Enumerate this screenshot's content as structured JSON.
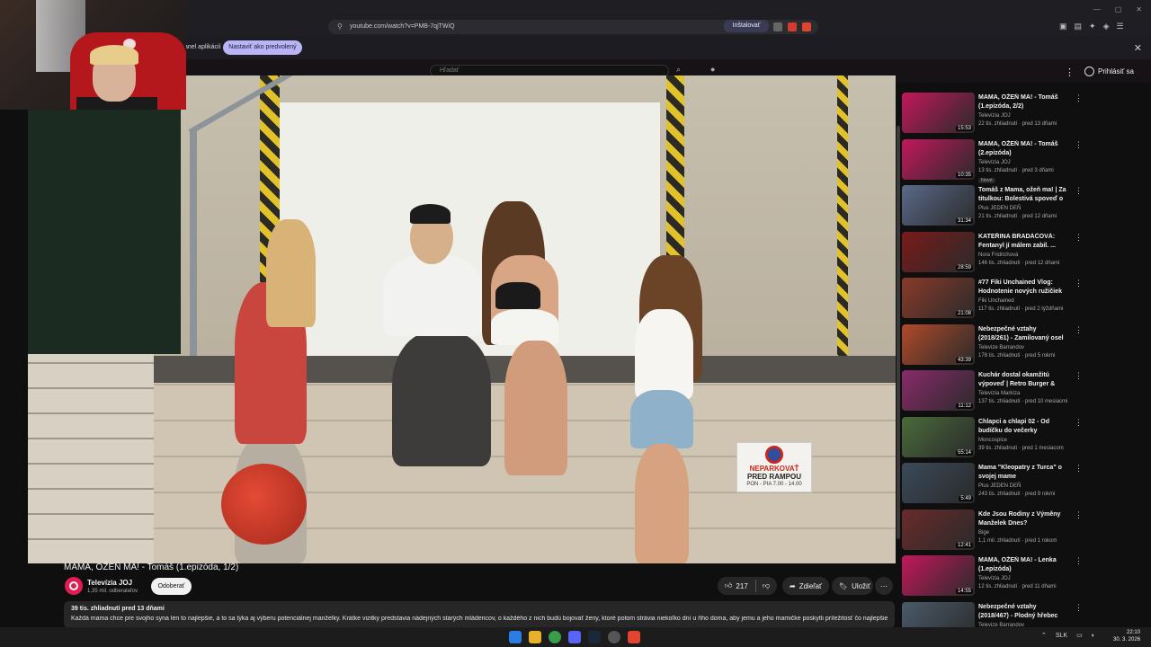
{
  "browser": {
    "url": "youtube.com/watch?v=PMB-7qjTWiQ",
    "install_label": "Inštalovať",
    "infobar_text": "anel aplikácií",
    "default_button": "Nastaviť ako predvolený"
  },
  "header": {
    "search_placeholder": "Hľadať",
    "signin_label": "Prihlásiť sa"
  },
  "video": {
    "title": "MAMA, OŽEŇ MA! - Tomáš (1.epizóda, 1/2)",
    "sign": {
      "line1": "NEPARKOVAŤ",
      "line2": "PRED RAMPOU",
      "line3": "PON - PIA 7.00 - 14.00"
    }
  },
  "channel": {
    "name": "Televízia JOJ",
    "subscribers": "1,35 mil. odberateľov",
    "subscribe_label": "Odoberať"
  },
  "actions": {
    "likes": "217",
    "share_label": "Zdieľať",
    "save_label": "Uložiť"
  },
  "description": {
    "meta": "39 tis. zhliadnutí  pred 13 dňami",
    "text": "Každá mama chce pre svojho syna len to najlepšie, a to sa týka aj výberu potenciálnej manželky. Krátke vizitky predstavia nádejných starých mládencov, o každého z nich budú bojovať ženy, ktoré potom strávia niekoľko dní u ňho doma, aby jemu a jeho mamičke poskytli príležitosť čo najlepšie"
  },
  "recommendations": [
    {
      "title": "MAMA, OŽEŇ MA! - Tomáš (1.epizóda, 2/2)",
      "channel": "Televízia JOJ",
      "meta": "22 tis. zhliadnutí · pred 13 dňami",
      "duration": "15:53",
      "badge": "",
      "color": "#c2185b"
    },
    {
      "title": "MAMA, OŽEŇ MA! - Tomáš (2.epizóda)",
      "channel": "Televízia JOJ",
      "meta": "13 tis. zhliadnutí · pred 3 dňami",
      "duration": "10:35",
      "badge": "Nové",
      "color": "#c2185b"
    },
    {
      "title": "Tomáš z Mama, ožeň ma! | Za titulkou: Bolestivá spoveď o ...",
      "channel": "Plus JEDEN DEŇ",
      "meta": "21 tis. zhliadnutí · pred 12 dňami",
      "duration": "31:34",
      "badge": "",
      "color": "#5a6a8a"
    },
    {
      "title": "KATEŘINA BRADÁČOVÁ: Fentanyl jí málem zabil. ...",
      "channel": "Nora Fridrichová",
      "meta": "146 tis. zhliadnutí · pred 12 dňami",
      "duration": "28:59",
      "badge": "",
      "color": "#7a1a1a"
    },
    {
      "title": "#77 Fiki Unchained Vlog: Hodnotenie nových ružičiek",
      "channel": "Fiki Unchained",
      "meta": "117 tis. zhliadnutí · pred 2 týždňami",
      "duration": "21:08",
      "badge": "",
      "color": "#8a3a2a"
    },
    {
      "title": "Nebezpečné vztahy (2018/261) - Zamilovaný osel",
      "channel": "Televize Barrandov",
      "meta": "178 tis. zhliadnutí · pred 5 rokmi",
      "duration": "43:39",
      "badge": "",
      "color": "#b04a2a"
    },
    {
      "title": "Kuchár dostal okamžitú výpoveď | Retro Burger & Dinn...",
      "channel": "Televízia Markíza",
      "meta": "137 tis. zhliadnutí · pred 10 mesiacmi",
      "duration": "11:12",
      "badge": "",
      "color": "#8a2a6a"
    },
    {
      "title": "Chlapci a chlapi 02 - Od budíčku do večerky",
      "channel": "Moncospice",
      "meta": "39 tis. zhliadnutí · pred 1 mesiacom",
      "duration": "55:14",
      "badge": "",
      "color": "#4a6a3a"
    },
    {
      "title": "Mama \"Kleopatry z Turca\" o svojej mame",
      "channel": "Plus JEDEN DEŇ",
      "meta": "243 tis. zhliadnutí · pred 9 rokmi",
      "duration": "5:49",
      "badge": "",
      "color": "#3a4a5a"
    },
    {
      "title": "Kde Jsou Rodiny z Výměny Manželek Dnes?",
      "channel": "Bige",
      "meta": "1,1 mil. zhliadnutí · pred 1 rokom",
      "duration": "12:41",
      "badge": "",
      "color": "#6a2a2a"
    },
    {
      "title": "MAMA, OŽEŇ MA! - Lenka (1.epizóda)",
      "channel": "Televízia JOJ",
      "meta": "12 tis. zhliadnutí · pred 11 dňami",
      "duration": "14:55",
      "badge": "",
      "color": "#c2185b"
    },
    {
      "title": "Nebezpečné vztahy (2018/467) - Plodný hřebec",
      "channel": "Televize Barrandov",
      "meta": "",
      "duration": "",
      "badge": "",
      "color": "#4a5a6a"
    }
  ],
  "taskbar": {
    "lang": "SLK",
    "time": "22:10",
    "date": "30. 3. 2026"
  }
}
